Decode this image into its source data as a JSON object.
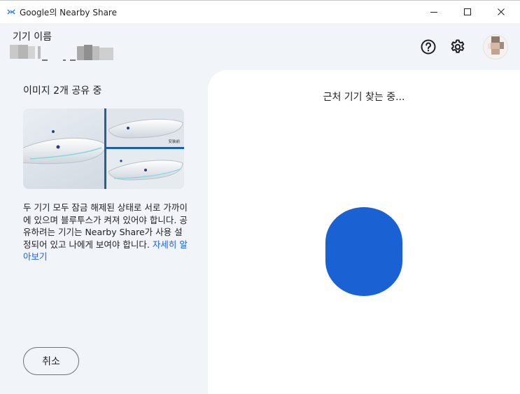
{
  "window": {
    "title": "Google의 Nearby Share",
    "minimize_icon": "minimize-icon",
    "maximize_icon": "maximize-icon",
    "close_icon": "close-icon"
  },
  "header": {
    "device_label": "기기 이름",
    "help_icon": "help-circle-icon",
    "settings_icon": "gear-icon",
    "avatar_icon": "avatar"
  },
  "sharing": {
    "title": "이미지 2개 공유 중",
    "thumbnail_watermark": "安装前",
    "description": "두 기기 모두 잠금 해제된 상태로 서로 가까이에 있으며 블루투스가 켜져 있어야 합니다. 공유하려는 기기는 Nearby Share가 사용 설정되어 있고 나에게 보여야 합니다. ",
    "learn_more": "자세히 알아보기",
    "cancel_label": "취소"
  },
  "discovery": {
    "status": "근처 기기 찾는 중..."
  },
  "colors": {
    "accent": "#1a62d3",
    "background": "#f1f4f9",
    "panel": "#ffffff"
  }
}
